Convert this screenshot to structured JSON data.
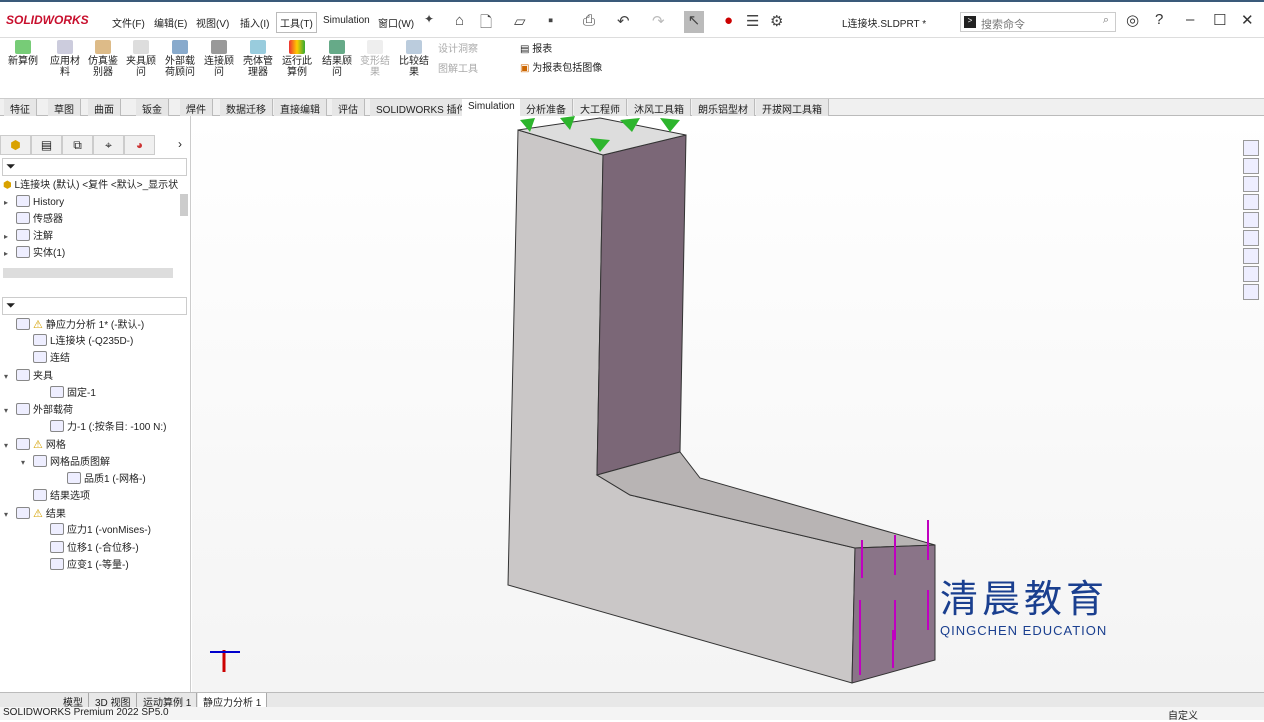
{
  "app": {
    "logo": "SOLIDWORKS",
    "document_title": "L连接块.SLDPRT *",
    "search_placeholder": "搜索命令"
  },
  "menu": [
    "文件(F)",
    "编辑(E)",
    "视图(V)",
    "插入(I)",
    "工具(T)",
    "Simulation",
    "窗口(W)"
  ],
  "ribbon": {
    "buttons": [
      "新算例",
      "应用材料",
      "仿真鉴别器",
      "夹具顾问",
      "外部载荷顾问",
      "连接顾问",
      "壳体管理器",
      "运行此算例",
      "结果顾问",
      "变形结果",
      "比较结果"
    ],
    "small": [
      "设计洞察",
      "图解工具",
      "报表",
      "为报表包括图像"
    ]
  },
  "tabs": [
    "特征",
    "草图",
    "曲面",
    "钣金",
    "焊件",
    "数据迁移",
    "直接编辑",
    "评估",
    "SOLIDWORKS 插件",
    "Simulation",
    "分析准备",
    "大工程师",
    "沐风工具箱",
    "朗乐铝型材",
    "开拔网工具箱"
  ],
  "feature_tree": {
    "root": "L连接块 (默认) <复件 <默认>_显示状",
    "items": [
      "History",
      "传感器",
      "注解",
      "实体(1)"
    ]
  },
  "sim_tree": [
    "静应力分析 1* (-默认-)",
    "L连接块 (-Q235D-)",
    "连结",
    "夹具",
    "固定-1",
    "外部载荷",
    "力-1 (:按条目: -100 N:)",
    "网格",
    "网格品质图解",
    "品质1 (-网格-)",
    "结果选项",
    "结果",
    "应力1 (-vonMises-)",
    "位移1 (-合位移-)",
    "应变1 (-等量-)"
  ],
  "bottom_tabs": [
    "模型",
    "3D 视图",
    "运动算例 1",
    "静应力分析 1"
  ],
  "status": {
    "left": "SOLIDWORKS Premium 2022 SP5.0",
    "right": "自定义"
  },
  "watermark": {
    "cn": "清晨教育",
    "en": "QINGCHEN EDUCATION"
  },
  "colors": {
    "brand": "#c8102e",
    "load": "#c000c0",
    "fixture": "#2db52d"
  }
}
